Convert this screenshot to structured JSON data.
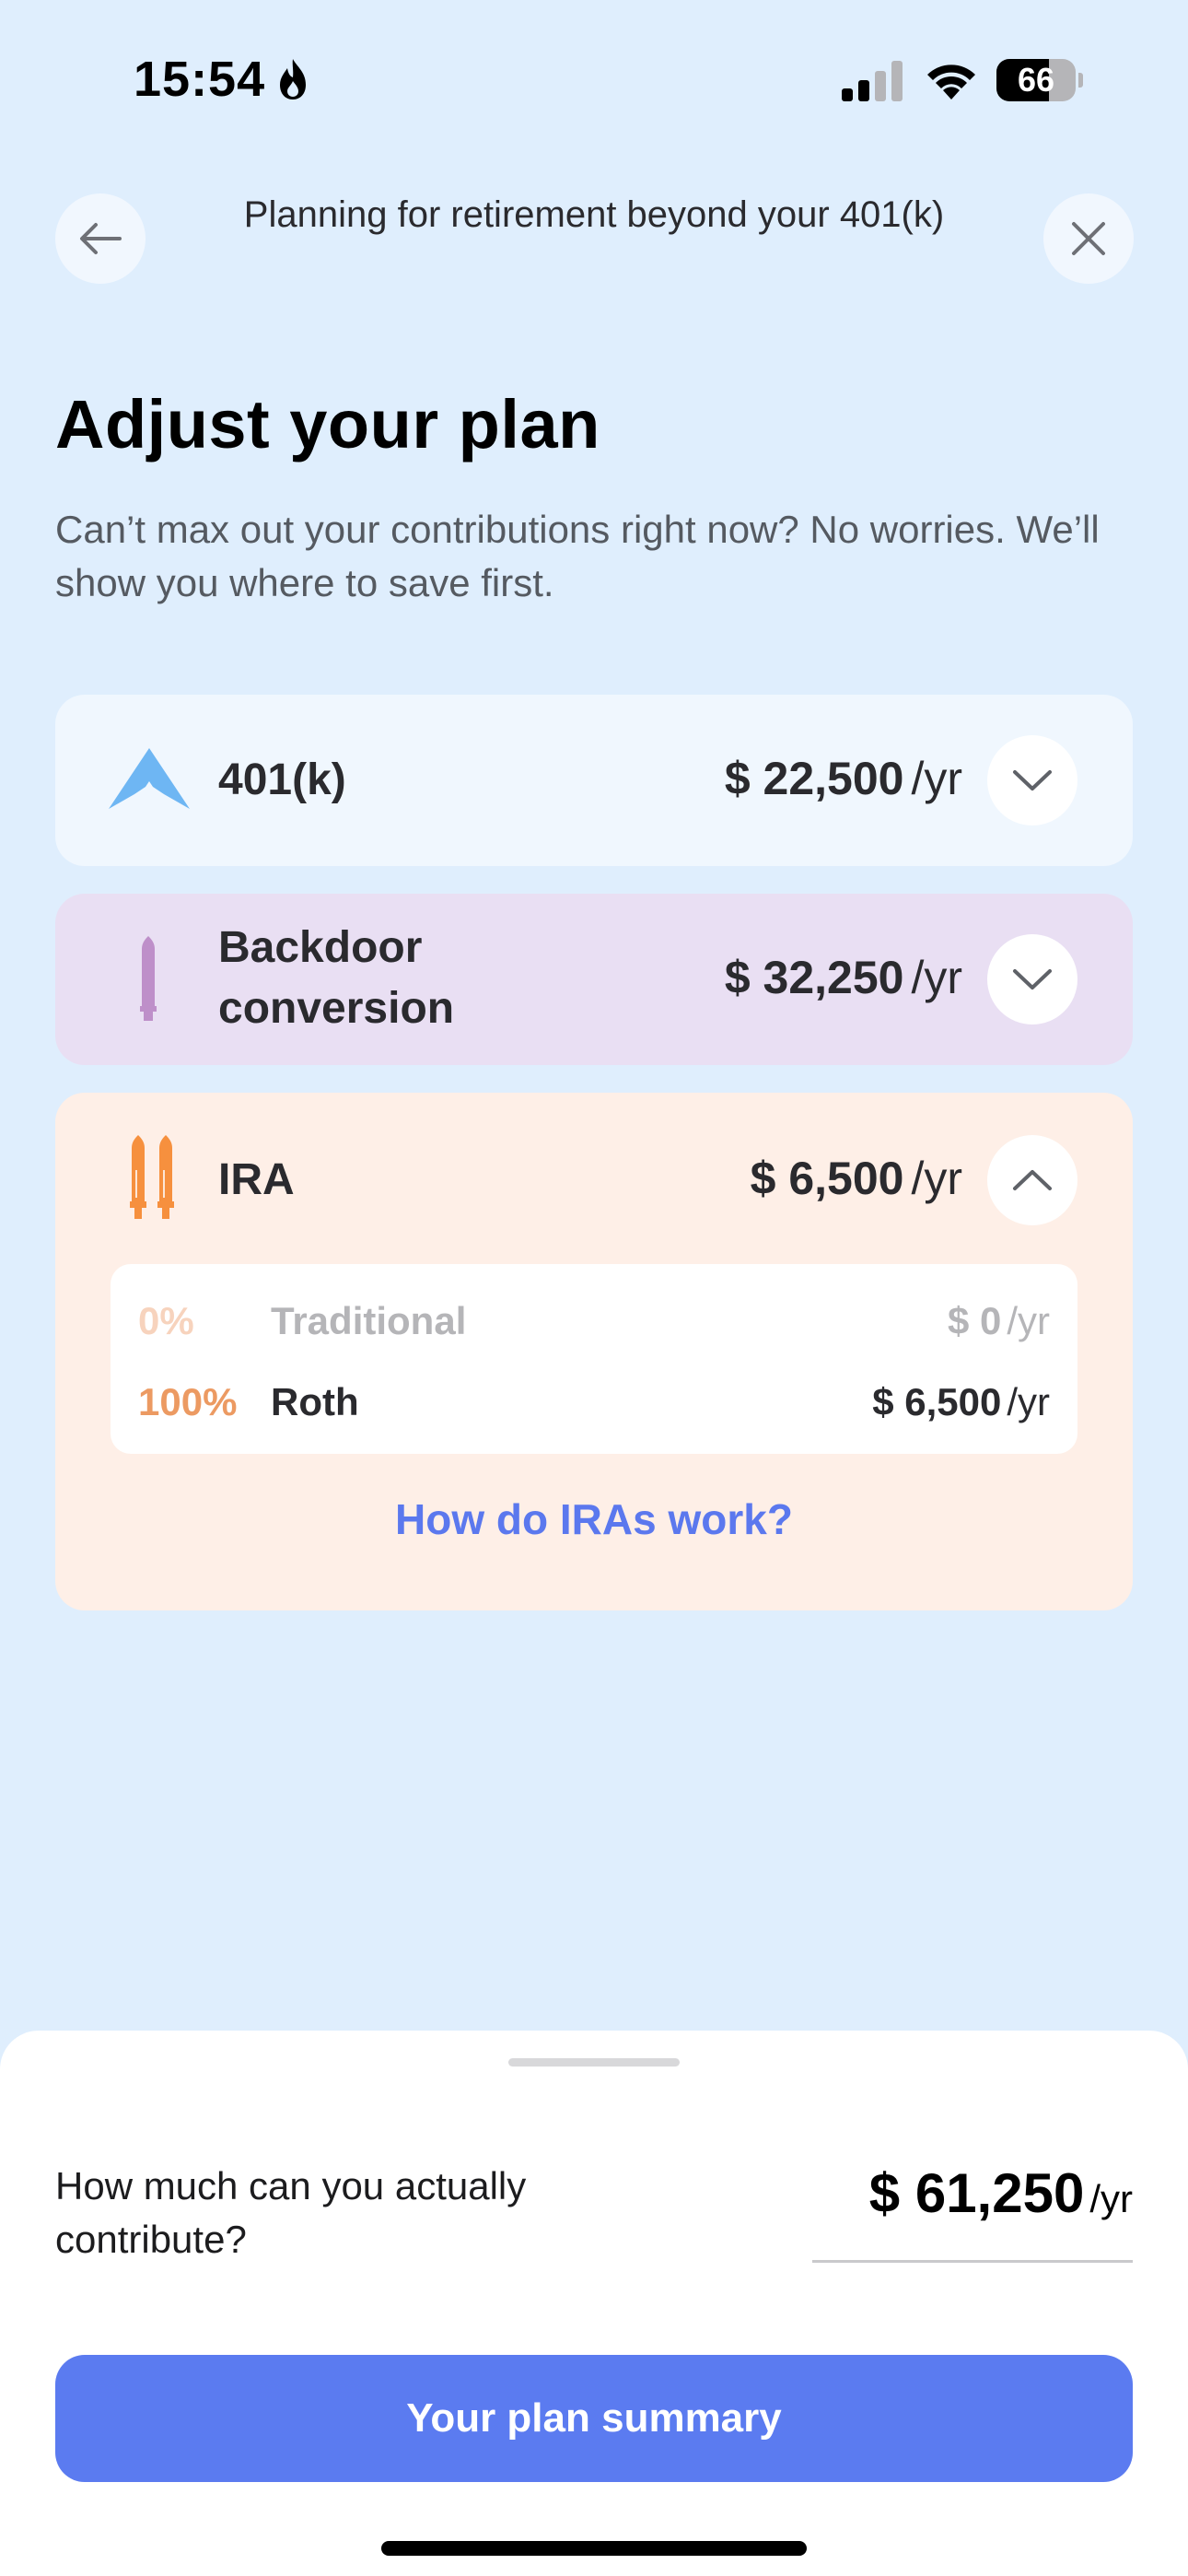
{
  "status": {
    "time": "15:54",
    "battery_level": 66,
    "battery_label": "66"
  },
  "header": {
    "title": "Planning for retirement beyond your 401(k)"
  },
  "page": {
    "title": "Adjust your plan",
    "subtitle": "Can’t max out your contributions right now? No worries. We’ll show you where to save first."
  },
  "accounts": [
    {
      "label": "401(k)",
      "amount": "$ 22,500",
      "unit": "/yr",
      "expanded": false,
      "color": "#6eb6f3",
      "icon": "mountain-icon"
    },
    {
      "label": "Backdoor conversion",
      "amount": "$ 32,250",
      "unit": "/yr",
      "expanded": false,
      "color": "#be8fc9",
      "icon": "rocket-icon"
    },
    {
      "label": "IRA",
      "amount": "$ 6,500",
      "unit": "/yr",
      "expanded": true,
      "color": "#f6903e",
      "icon": "twin-rockets-icon"
    }
  ],
  "ira_breakdown": [
    {
      "percent": "0%",
      "name": "Traditional",
      "amount": "$ 0",
      "unit": "/yr"
    },
    {
      "percent": "100%",
      "name": "Roth",
      "amount": "$ 6,500",
      "unit": "/yr"
    }
  ],
  "ira_link": "How do IRAs work?",
  "sheet": {
    "question": "How much can you actually contribute?",
    "value": "$ 61,250",
    "unit": "/yr",
    "button_label": "Your plan summary"
  },
  "colors": {
    "background": "#dfeefd",
    "accent": "#5b7bf0",
    "card_401k": "#f0f7fe",
    "card_backdoor": "#e9dff3",
    "card_ira": "#feefe7"
  }
}
